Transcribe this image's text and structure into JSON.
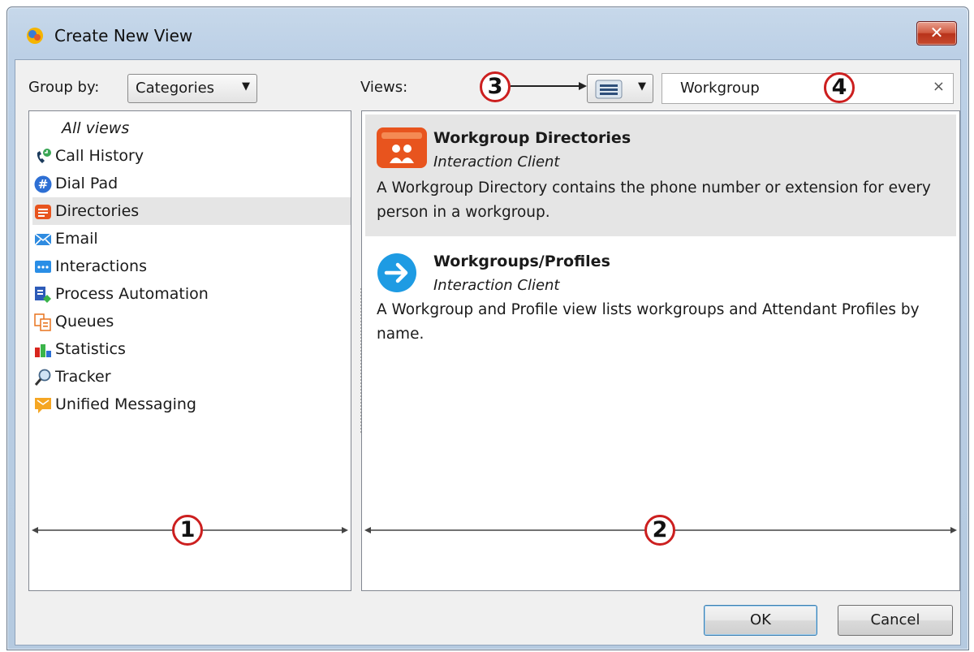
{
  "window": {
    "title": "Create New View"
  },
  "group_by": {
    "label": "Group by:",
    "selected": "Categories"
  },
  "views": {
    "label": "Views:"
  },
  "search": {
    "value": "Workgroup",
    "clear_glyph": "×"
  },
  "categories": [
    {
      "label": "All views",
      "icon": "none"
    },
    {
      "label": "Call History",
      "icon": "phone-history-icon"
    },
    {
      "label": "Dial Pad",
      "icon": "dial-pad-icon"
    },
    {
      "label": "Directories",
      "icon": "directories-icon"
    },
    {
      "label": "Email",
      "icon": "email-icon"
    },
    {
      "label": "Interactions",
      "icon": "interactions-icon"
    },
    {
      "label": "Process Automation",
      "icon": "process-automation-icon"
    },
    {
      "label": "Queues",
      "icon": "queues-icon"
    },
    {
      "label": "Statistics",
      "icon": "statistics-icon"
    },
    {
      "label": "Tracker",
      "icon": "tracker-icon"
    },
    {
      "label": "Unified Messaging",
      "icon": "unified-messaging-icon"
    }
  ],
  "selected_category": "Directories",
  "view_results": [
    {
      "title": "Workgroup Directories",
      "subtitle": "Interaction Client",
      "description": "A Workgroup Directory contains the phone number or extension for every person in a workgroup.",
      "icon": "workgroup-directory-icon"
    },
    {
      "title": "Workgroups/Profiles",
      "subtitle": "Interaction Client",
      "description": "A Workgroup and Profile view lists workgroups and Attendant Profiles by name.",
      "icon": "arrow-right-circle-icon"
    }
  ],
  "buttons": {
    "ok": "OK",
    "cancel": "Cancel"
  },
  "callouts": [
    "1",
    "2",
    "3",
    "4"
  ],
  "colors": {
    "callout_red": "#cc1f1f",
    "selection": "#e5e5e5",
    "close_red": "#c74a2e"
  }
}
